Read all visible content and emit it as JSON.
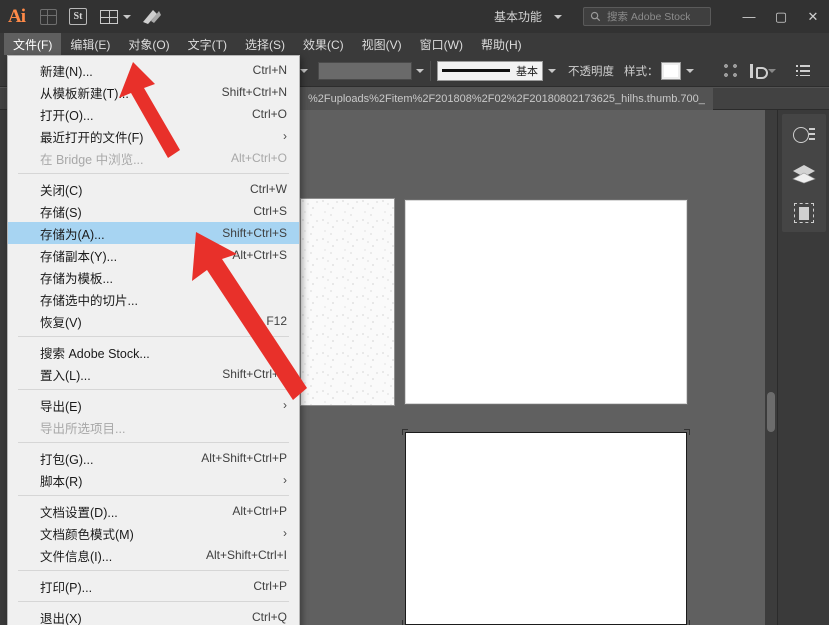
{
  "app": {
    "name": "Adobe Illustrator",
    "logo_text": "Ai"
  },
  "titlebar": {
    "icons": [
      {
        "name": "bridge-icon",
        "label": "Br"
      },
      {
        "name": "stock-icon",
        "label": "St"
      },
      {
        "name": "arrange-documents-icon",
        "label": "排列文档"
      },
      {
        "name": "adobe-swoosh-icon",
        "label": "Adobe"
      }
    ],
    "workspace_label": "基本功能",
    "search_placeholder": "搜索 Adobe Stock",
    "window_controls": {
      "minimize": "—",
      "maximize": "▢",
      "close": "✕"
    }
  },
  "menubar": {
    "items": [
      {
        "label": "文件(F)",
        "open": true
      },
      {
        "label": "编辑(E)",
        "open": false
      },
      {
        "label": "对象(O)",
        "open": false
      },
      {
        "label": "文字(T)",
        "open": false
      },
      {
        "label": "选择(S)",
        "open": false
      },
      {
        "label": "效果(C)",
        "open": false
      },
      {
        "label": "视图(V)",
        "open": false
      },
      {
        "label": "窗口(W)",
        "open": false
      },
      {
        "label": "帮助(H)",
        "open": false
      }
    ]
  },
  "controlbar": {
    "stroke_label": "基本",
    "opacity_label": "不透明度",
    "style_label": "样式：",
    "buttons": [
      {
        "name": "align-button"
      },
      {
        "name": "transform-button"
      },
      {
        "name": "options-button"
      }
    ]
  },
  "document_tab": {
    "title": "%2Fuploads%2Fitem%2F201808%2F02%2F20180802173625_hilhs.thumb.700_"
  },
  "file_menu": {
    "groups": [
      {
        "items": [
          {
            "label": "新建(N)...",
            "shortcut": "Ctrl+N",
            "disabled": false,
            "submenu": false,
            "selected": false
          },
          {
            "label": "从模板新建(T)...",
            "shortcut": "Shift+Ctrl+N",
            "disabled": false,
            "submenu": false,
            "selected": false
          },
          {
            "label": "打开(O)...",
            "shortcut": "Ctrl+O",
            "disabled": false,
            "submenu": false,
            "selected": false
          },
          {
            "label": "最近打开的文件(F)",
            "shortcut": "",
            "disabled": false,
            "submenu": true,
            "selected": false
          },
          {
            "label": "在 Bridge 中浏览...",
            "shortcut": "Alt+Ctrl+O",
            "disabled": true,
            "submenu": false,
            "selected": false
          }
        ]
      },
      {
        "items": [
          {
            "label": "关闭(C)",
            "shortcut": "Ctrl+W",
            "disabled": false,
            "submenu": false,
            "selected": false
          },
          {
            "label": "存储(S)",
            "shortcut": "Ctrl+S",
            "disabled": false,
            "submenu": false,
            "selected": false
          },
          {
            "label": "存储为(A)...",
            "shortcut": "Shift+Ctrl+S",
            "disabled": false,
            "submenu": false,
            "selected": true
          },
          {
            "label": "存储副本(Y)...",
            "shortcut": "Alt+Ctrl+S",
            "disabled": false,
            "submenu": false,
            "selected": false
          },
          {
            "label": "存储为模板...",
            "shortcut": "",
            "disabled": false,
            "submenu": false,
            "selected": false
          },
          {
            "label": "存储选中的切片...",
            "shortcut": "",
            "disabled": false,
            "submenu": false,
            "selected": false
          },
          {
            "label": "恢复(V)",
            "shortcut": "F12",
            "disabled": false,
            "submenu": false,
            "selected": false
          }
        ]
      },
      {
        "items": [
          {
            "label": "搜索 Adobe Stock...",
            "shortcut": "",
            "disabled": false,
            "submenu": false,
            "selected": false
          },
          {
            "label": "置入(L)...",
            "shortcut": "Shift+Ctrl+P",
            "disabled": false,
            "submenu": false,
            "selected": false
          }
        ]
      },
      {
        "items": [
          {
            "label": "导出(E)",
            "shortcut": "",
            "disabled": false,
            "submenu": true,
            "selected": false
          },
          {
            "label": "导出所选项目...",
            "shortcut": "",
            "disabled": true,
            "submenu": false,
            "selected": false
          }
        ]
      },
      {
        "items": [
          {
            "label": "打包(G)...",
            "shortcut": "Alt+Shift+Ctrl+P",
            "disabled": false,
            "submenu": false,
            "selected": false
          },
          {
            "label": "脚本(R)",
            "shortcut": "",
            "disabled": false,
            "submenu": true,
            "selected": false
          }
        ]
      },
      {
        "items": [
          {
            "label": "文档设置(D)...",
            "shortcut": "Alt+Ctrl+P",
            "disabled": false,
            "submenu": false,
            "selected": false
          },
          {
            "label": "文档颜色模式(M)",
            "shortcut": "",
            "disabled": false,
            "submenu": true,
            "selected": false
          },
          {
            "label": "文件信息(I)...",
            "shortcut": "Alt+Shift+Ctrl+I",
            "disabled": false,
            "submenu": false,
            "selected": false
          }
        ]
      },
      {
        "items": [
          {
            "label": "打印(P)...",
            "shortcut": "Ctrl+P",
            "disabled": false,
            "submenu": false,
            "selected": false
          }
        ]
      },
      {
        "items": [
          {
            "label": "退出(X)",
            "shortcut": "Ctrl+Q",
            "disabled": false,
            "submenu": false,
            "selected": false
          }
        ]
      }
    ]
  },
  "dock": {
    "items": [
      {
        "name": "properties-panel-icon",
        "label": "属性"
      },
      {
        "name": "layers-panel-icon",
        "label": "图层"
      },
      {
        "name": "artboards-panel-icon",
        "label": "画板"
      }
    ]
  },
  "annotations": {
    "arrow_color": "#e8302a",
    "arrows": [
      {
        "name": "arrow-pointing-to-new-file",
        "target": "新建(N)..."
      },
      {
        "name": "arrow-pointing-to-save-as",
        "target": "存储为(A)..."
      }
    ]
  },
  "colors": {
    "chrome_dark": "#323232",
    "panel_bg": "#3a3a3a",
    "canvas_bg": "#606060",
    "menu_bg": "#f0f0f0",
    "menu_highlight": "#a7d4f2",
    "accent_orange": "#ff8a48",
    "annotation_red": "#e8302a"
  }
}
